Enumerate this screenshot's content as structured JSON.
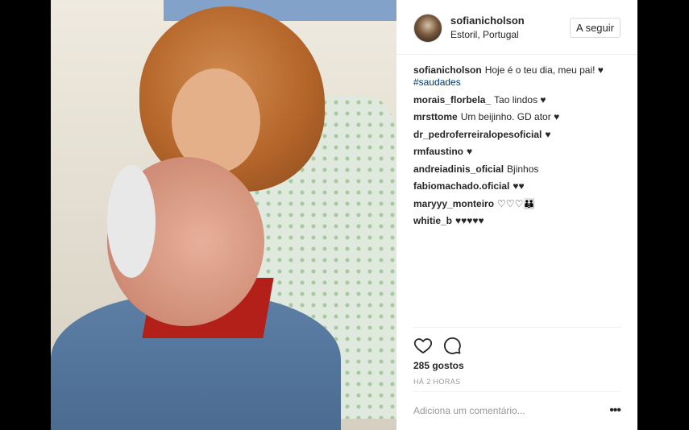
{
  "post": {
    "username": "sofianicholson",
    "location": "Estoril, Portugal",
    "follow_label": "A seguir",
    "caption": {
      "user": "sofianicholson",
      "text": "Hoje é o teu dia, meu pai! ♥",
      "hashtag": "#saudades"
    },
    "comments": [
      {
        "user": "morais_florbela_",
        "text": "Tao lindos ♥"
      },
      {
        "user": "mrsttome",
        "text": "Um beijinho. GD ator ♥"
      },
      {
        "user": "dr_pedroferreiralopesoficial",
        "text": "♥"
      },
      {
        "user": "rmfaustino",
        "text": "♥"
      },
      {
        "user": "andreiadinis_oficial",
        "text": "Bjinhos"
      },
      {
        "user": "fabiomachado.oficial",
        "text": "♥♥"
      },
      {
        "user": "maryyy_monteiro",
        "text": "♡♡♡👪"
      },
      {
        "user": "whitie_b",
        "text": "♥♥♥♥♥"
      }
    ],
    "likes": "285 gostos",
    "time": "HÁ 2 HORAS",
    "add_comment_placeholder": "Adiciona um comentário...",
    "more_label": "•••"
  },
  "icons": {
    "like": "heart-outline-icon",
    "comment": "speech-bubble-icon",
    "more": "ellipsis-icon"
  },
  "colors": {
    "text": "#262626",
    "muted": "#999999",
    "link": "#003569",
    "border": "#efefef"
  }
}
